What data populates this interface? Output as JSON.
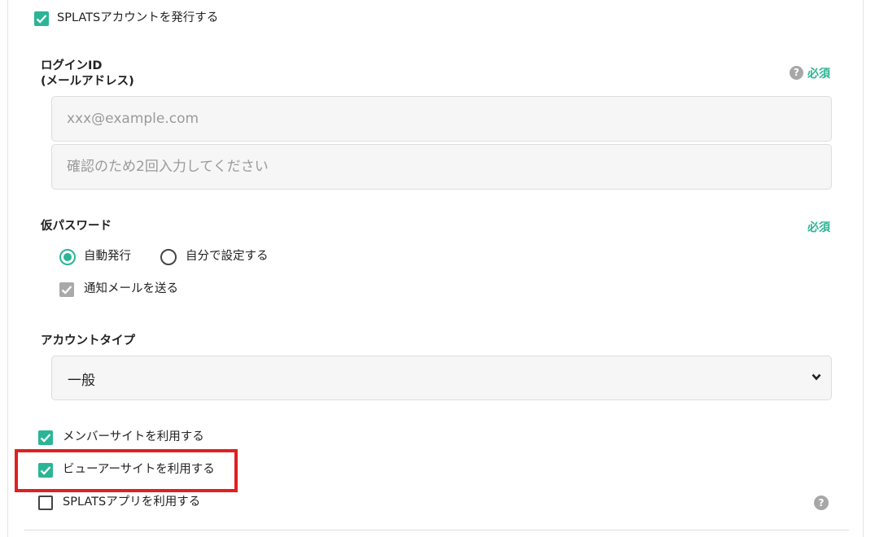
{
  "issue_account": {
    "label": "SPLATSアカウントを発行する",
    "checked": true
  },
  "login_id": {
    "title_line1": "ログインID",
    "title_line2": "(メールアドレス)",
    "required_label": "必須",
    "help_icon": "question-circle-icon",
    "email_placeholder": "xxx@example.com",
    "confirm_placeholder": "確認のため2回入力してください"
  },
  "temp_password": {
    "title": "仮パスワード",
    "required_label": "必須",
    "options": [
      {
        "label": "自動発行",
        "selected": true
      },
      {
        "label": "自分で設定する",
        "selected": false
      }
    ],
    "notify_mail": {
      "label": "通知メールを送る",
      "checked": true,
      "disabled": true
    }
  },
  "account_type": {
    "title": "アカウントタイプ",
    "selected_value": "一般",
    "dropdown_icon": "chevron-down-icon"
  },
  "site_usage": [
    {
      "label": "メンバーサイトを利用する",
      "checked": true
    },
    {
      "label": "ビューアーサイトを利用する",
      "checked": true,
      "highlighted": true
    },
    {
      "label": "SPLATSアプリを利用する",
      "checked": false
    }
  ],
  "colors": {
    "accent": "#2bb596",
    "highlight_border": "#e02020",
    "disabled_checkbox": "#a9a9a9",
    "field_background": "#f6f6f6"
  }
}
